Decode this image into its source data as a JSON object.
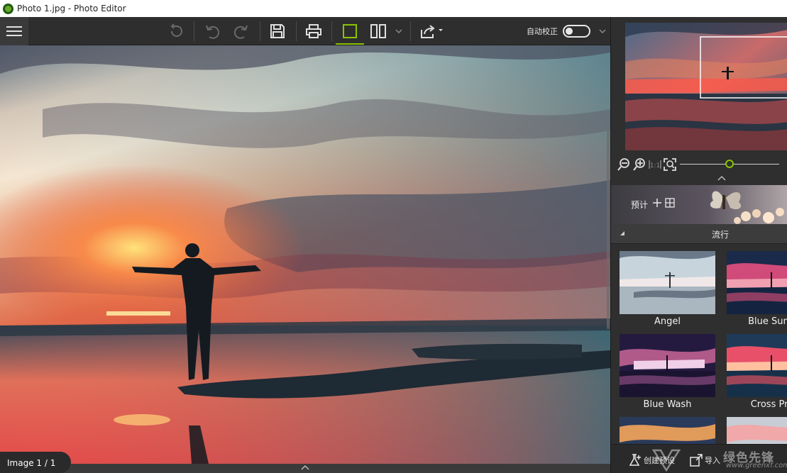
{
  "window": {
    "title": "Photo 1.jpg - Photo Editor"
  },
  "toolbar": {
    "autocorrect_label": "自动校正",
    "autocorrect_on": false,
    "icons": [
      "menu-icon",
      "rotate-icon",
      "undo-icon",
      "redo-icon",
      "save-icon",
      "print-icon",
      "single-view-icon",
      "compare-view-icon",
      "chevron-down-icon",
      "share-icon",
      "chevron-down-icon"
    ]
  },
  "canvas": {
    "image_counter": "Image 1 / 1"
  },
  "right_panel": {
    "zoom_level": 0.5,
    "presets_label": "预计",
    "category": "流行",
    "presets": [
      {
        "name": "Angel"
      },
      {
        "name": "Blue Summ"
      },
      {
        "name": "Blue Wash"
      },
      {
        "name": "Cross Proc"
      },
      {
        "name": ""
      },
      {
        "name": ""
      }
    ],
    "footer": {
      "create_preset": "创建预设",
      "import": "导入",
      "watermark_text": "绿色先锋",
      "watermark_url": "www.greenxf.com"
    }
  },
  "colors": {
    "accent": "#8bc400",
    "panel": "#2f2f2f",
    "toolbar": "#2e2e2e"
  }
}
